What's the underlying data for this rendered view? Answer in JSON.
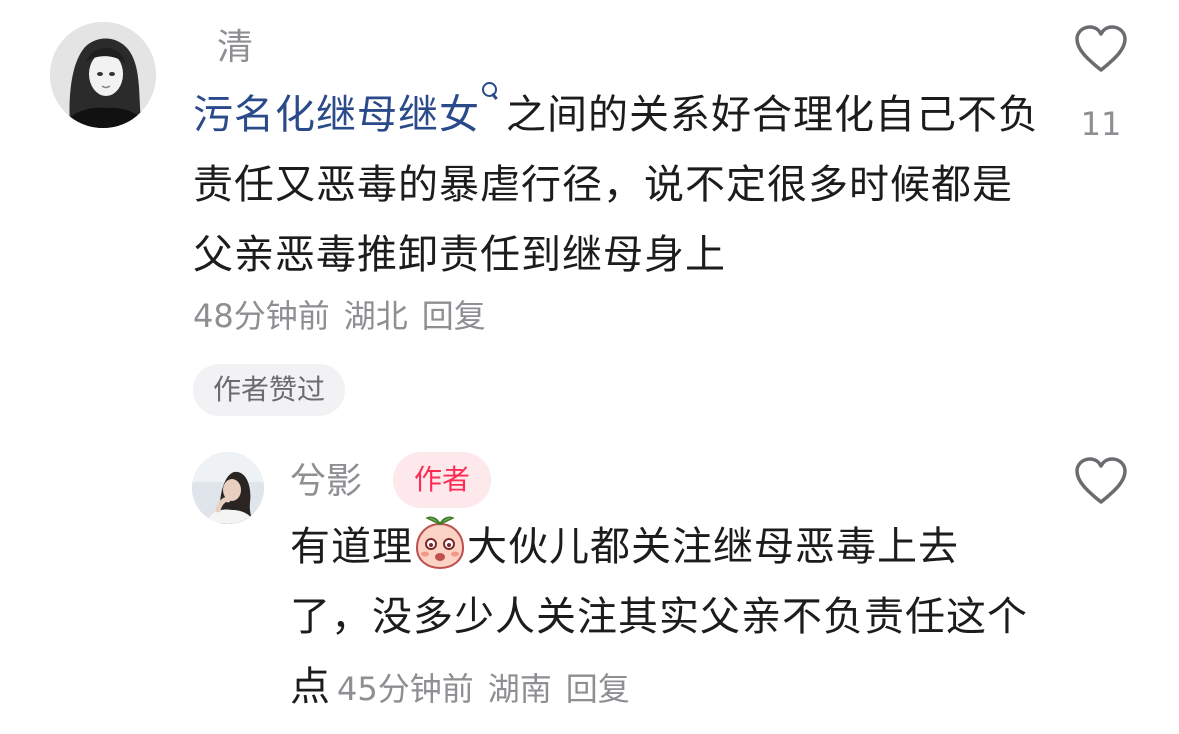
{
  "comment": {
    "username": "清",
    "hashtag": "污名化继母继女",
    "text_after_hashtag": "之间的关系好合理化自己不负责任又恶毒的暴虐行径，说不定很多时候都是父亲恶毒推卸责任到继母身上",
    "time": "48分钟前",
    "location": "湖北",
    "reply_label": "回复",
    "like_count": "11",
    "author_liked_label": "作者赞过",
    "avatar_icon": "avatar-girl-grayscale"
  },
  "reply": {
    "username": "兮影",
    "author_badge": "作者",
    "text_before_emoji": "有道理",
    "emoji": "peach-face-emoji",
    "text_after_emoji": "大伙儿都关注继母恶毒上去了，没多少人关注其实父亲不负责任这个点",
    "time": "45分钟前",
    "location": "湖南",
    "reply_label": "回复",
    "avatar_icon": "avatar-girl-photo"
  },
  "colors": {
    "hashtag": "#2a4a8a",
    "author_badge_text": "#fe2c55",
    "author_badge_bg": "#fde8ec",
    "meta_gray": "#8e8e93"
  }
}
